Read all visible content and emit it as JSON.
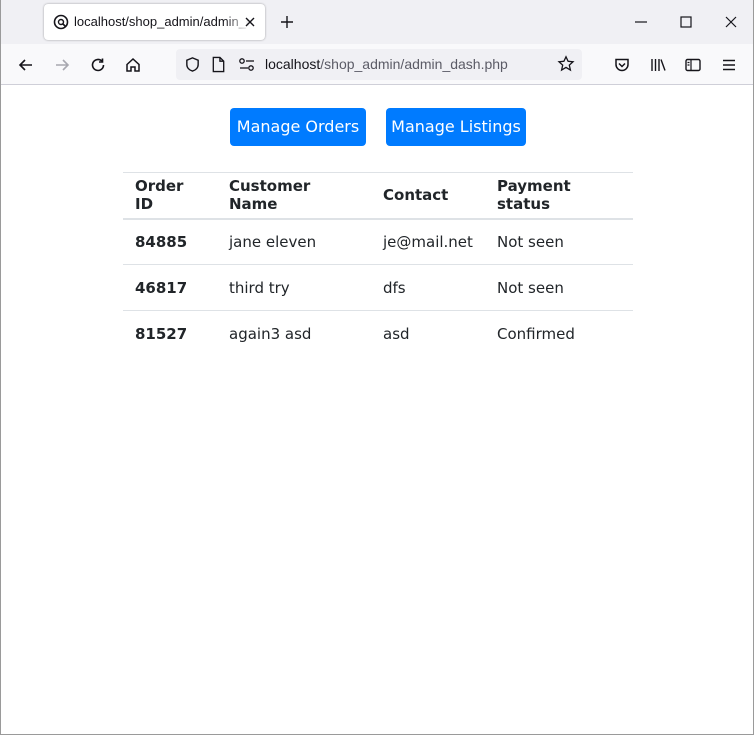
{
  "browser": {
    "tab": {
      "title": "localhost/shop_admin/admin_dash.php",
      "favicon": "globe-icon"
    },
    "new_tab_icon": "plus-icon",
    "window_controls": [
      "minimize-icon",
      "maximize-icon",
      "close-icon"
    ],
    "nav": {
      "url_host": "localhost",
      "url_path": "/shop_admin/admin_dash.php",
      "icons": [
        "back-icon",
        "forward-icon",
        "reload-icon",
        "home-icon",
        "shield-icon",
        "page-icon",
        "permissions-icon",
        "star-icon",
        "pocket-icon",
        "library-icon",
        "sidebar-icon",
        "menu-icon"
      ]
    }
  },
  "page": {
    "buttons": {
      "manage_orders": "Manage Orders",
      "manage_listings": "Manage Listings"
    },
    "table": {
      "headers": [
        "Order ID",
        "Customer Name",
        "Contact",
        "Payment status"
      ],
      "rows": [
        [
          "84885",
          "jane eleven",
          "je@mail.net",
          "Not seen"
        ],
        [
          "46817",
          "third try",
          "dfs",
          "Not seen"
        ],
        [
          "81527",
          "again3 asd",
          "asd",
          "Confirmed"
        ]
      ]
    },
    "colors": {
      "primary_button": "#007bff",
      "text": "#212529",
      "border": "#dee2e6"
    }
  }
}
